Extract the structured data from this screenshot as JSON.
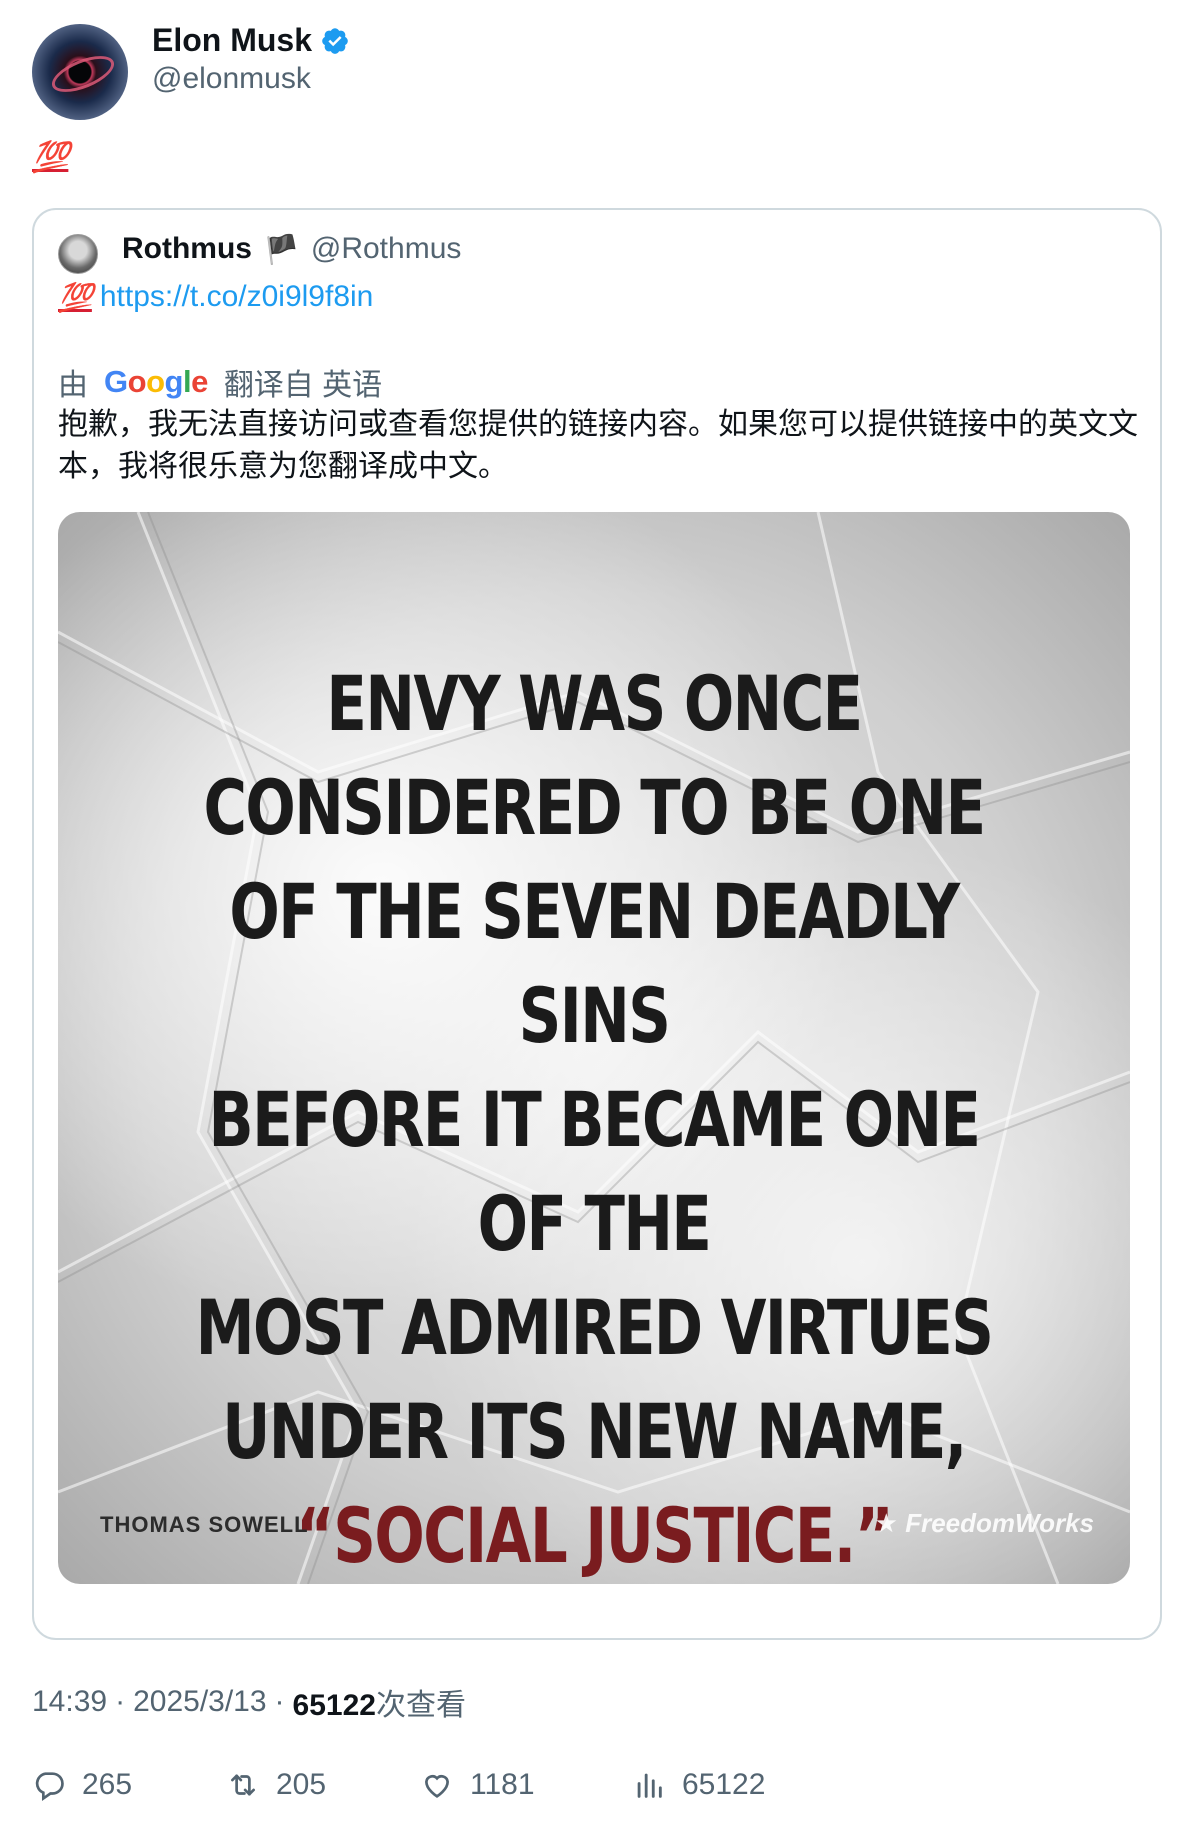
{
  "author": {
    "name": "Elon Musk",
    "handle": "@elonmusk",
    "verified_icon": "verified-badge-icon",
    "verified_color": "#1d9bf0"
  },
  "tweet": {
    "text": "💯"
  },
  "quoted": {
    "name": "Rothmus",
    "flag": "🏴",
    "handle": "@Rothmus",
    "emoji": "💯",
    "link": "https://t.co/z0i9l9f8in",
    "translate_prefix": "由",
    "translate_brand": "Google",
    "translate_suffix": "翻译自 英语",
    "translation": "抱歉，我无法直接访问或查看您提供的链接内容。如果您可以提供链接中的英文文本，我将很乐意为您翻译成中文。",
    "image": {
      "lines": [
        "ENVY WAS ONCE",
        "CONSIDERED TO BE ONE",
        "OF THE SEVEN DEADLY SINS",
        "BEFORE IT BECAME ONE OF THE",
        "MOST ADMIRED VIRTUES",
        "UNDER ITS NEW NAME,"
      ],
      "highlight": "“SOCIAL JUSTICE.”",
      "highlight_color": "#7a1c1f",
      "attribution": "THOMAS SOWELL",
      "watermark": "★ FreedomWorks"
    }
  },
  "meta": {
    "time": "14:39",
    "sep1": "·",
    "date": "2025/3/13",
    "sep2": "·",
    "views": "65122",
    "views_suffix": "次查看"
  },
  "actions": {
    "replies": "265",
    "reposts": "205",
    "likes": "1181",
    "views": "65122"
  }
}
